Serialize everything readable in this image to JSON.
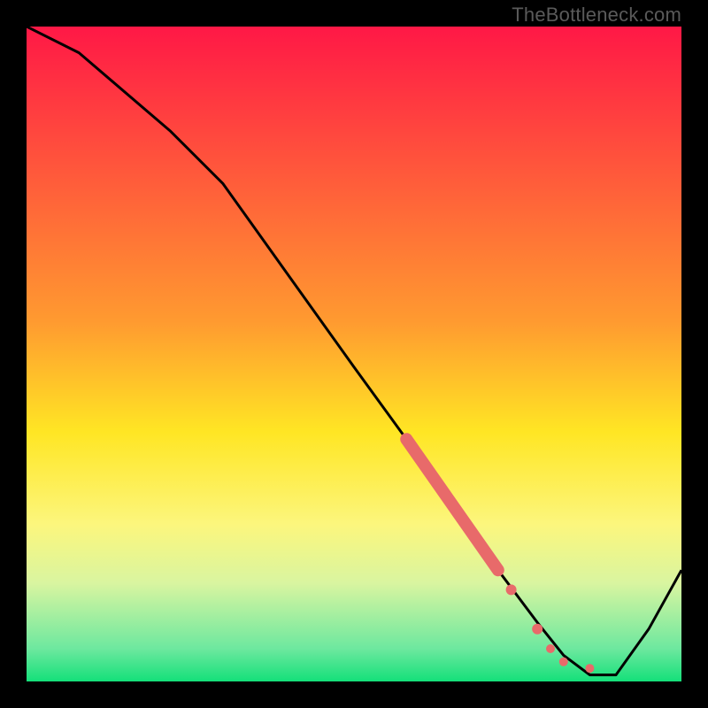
{
  "watermark": "TheBottleneck.com",
  "chart_data": {
    "type": "line",
    "title": "",
    "xlabel": "",
    "ylabel": "",
    "xlim": [
      0,
      100
    ],
    "ylim": [
      0,
      100
    ],
    "background_gradient": [
      {
        "stop": 0.0,
        "color": "#ff1846"
      },
      {
        "stop": 0.45,
        "color": "#ff9a30"
      },
      {
        "stop": 0.62,
        "color": "#ffe624"
      },
      {
        "stop": 0.76,
        "color": "#fcf67d"
      },
      {
        "stop": 0.85,
        "color": "#d9f5a0"
      },
      {
        "stop": 0.95,
        "color": "#6de89f"
      },
      {
        "stop": 1.0,
        "color": "#14e07a"
      }
    ],
    "series": [
      {
        "name": "bottleneck-curve",
        "color": "#000000",
        "x": [
          0,
          8,
          22,
          30,
          40,
          50,
          58,
          65,
          72,
          78,
          82,
          86,
          90,
          95,
          100
        ],
        "values": [
          100,
          96,
          84,
          76,
          62,
          48,
          37,
          27,
          17,
          9,
          4,
          1,
          1,
          8,
          17
        ]
      }
    ],
    "highlight_segment": {
      "name": "highlight",
      "color": "#e86a6a",
      "thick_points": [
        {
          "x": 58,
          "y": 37
        },
        {
          "x": 72,
          "y": 17
        }
      ],
      "dots": [
        {
          "x": 74,
          "y": 14
        },
        {
          "x": 78,
          "y": 8
        },
        {
          "x": 80,
          "y": 5
        },
        {
          "x": 82,
          "y": 3
        },
        {
          "x": 86,
          "y": 2
        }
      ]
    }
  }
}
